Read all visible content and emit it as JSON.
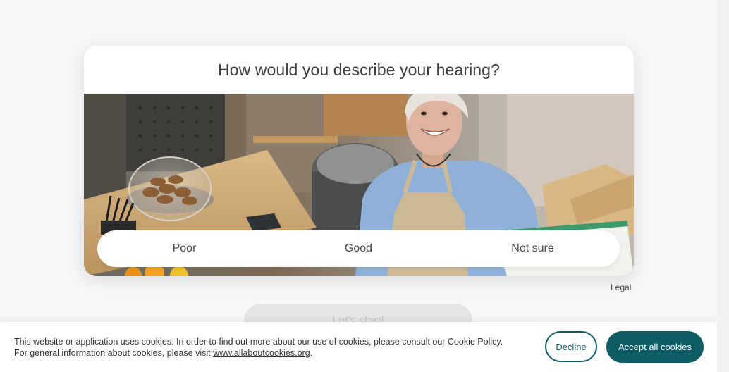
{
  "survey": {
    "question": "How would you describe your hearing?",
    "answers": [
      {
        "label": "Poor"
      },
      {
        "label": "Good"
      },
      {
        "label": "Not sure"
      }
    ]
  },
  "legal_link": "Legal",
  "start_button": "Let's start!",
  "cookie_banner": {
    "text_before_link": "This website or application uses cookies. In order to find out more about our use of cookies, please consult our Cookie Policy. For general information about cookies, please visit ",
    "link_text": "www.allaboutcookies.org",
    "text_after_link": ".",
    "decline_label": "Decline",
    "accept_label": "Accept all cookies"
  },
  "colors": {
    "accent": "#0d5c63",
    "page_background": "#f5f6f7"
  }
}
